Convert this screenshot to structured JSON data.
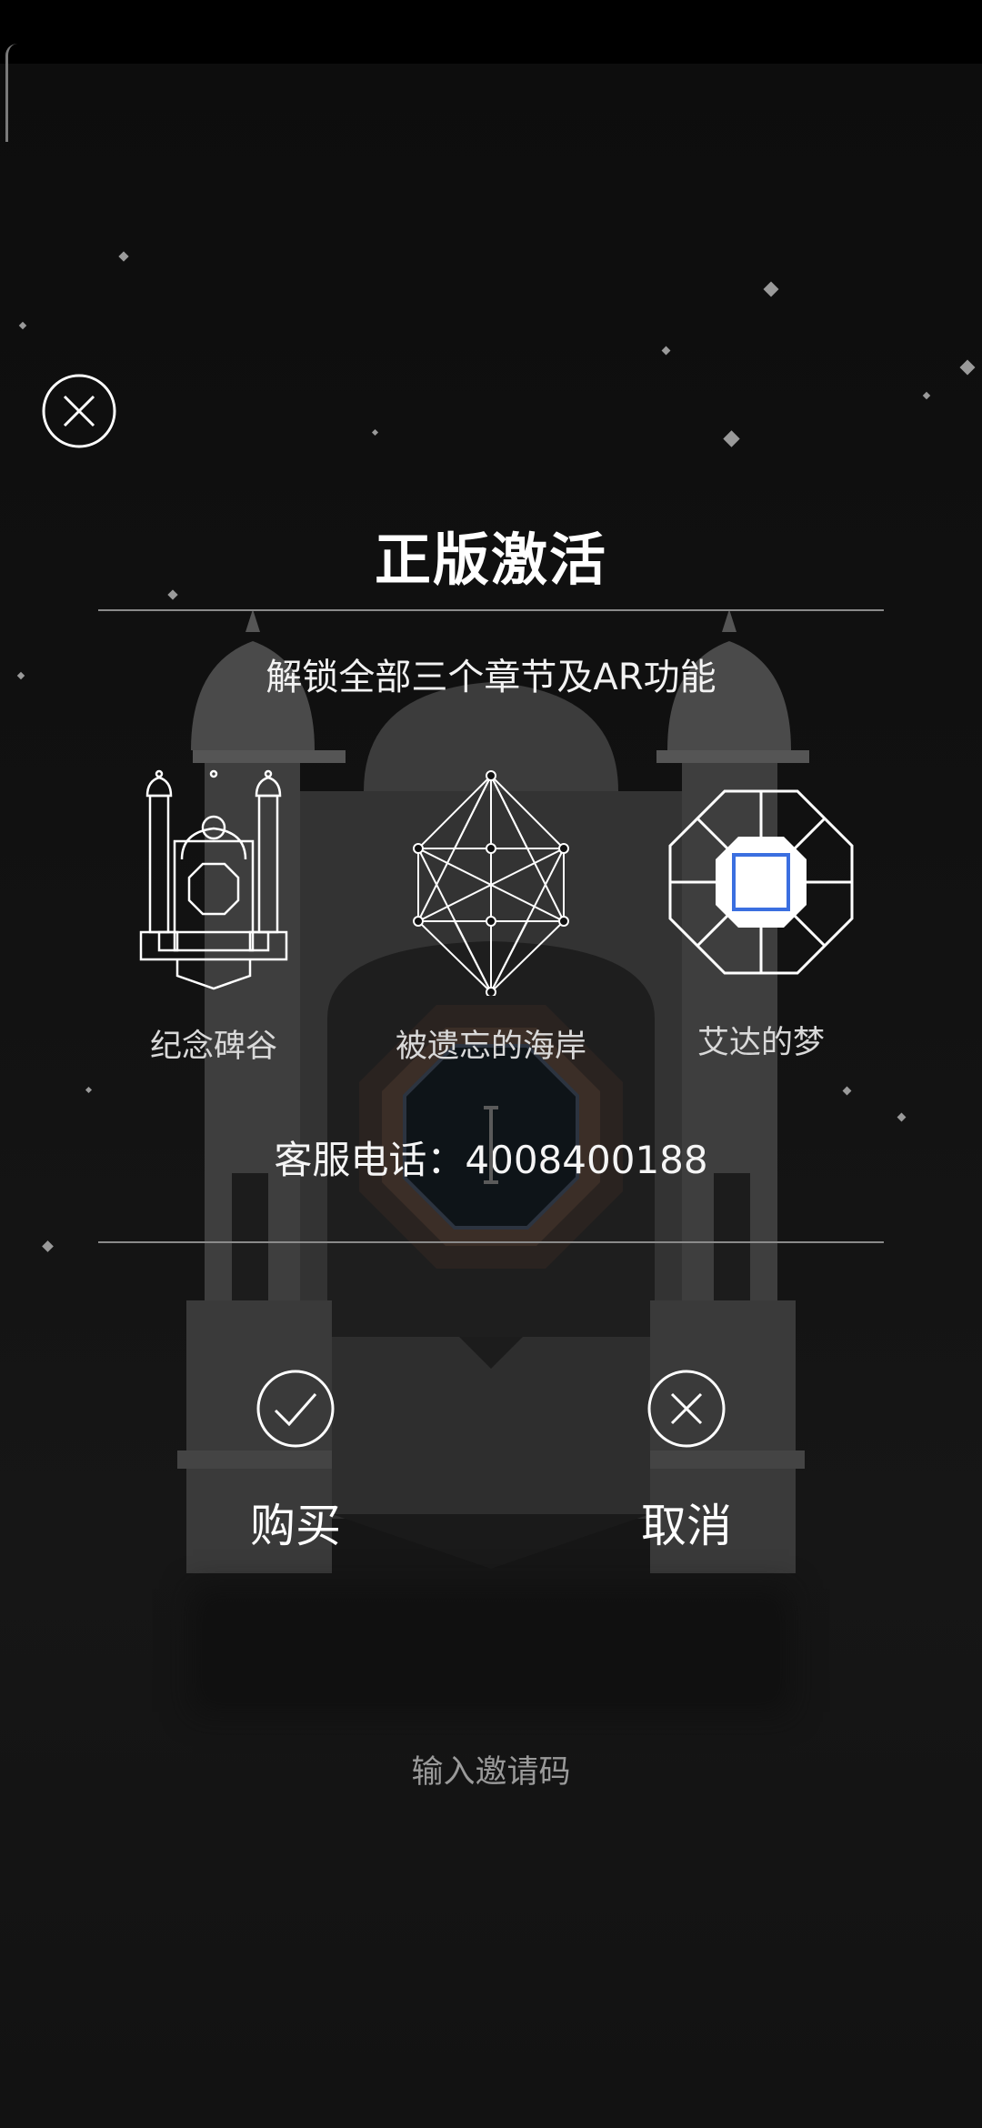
{
  "dialog": {
    "title": "正版激活",
    "subtitle": "解锁全部三个章节及AR功能",
    "chapters": [
      {
        "label": "纪念碑谷",
        "icon": "temple-icon"
      },
      {
        "label": "被遗忘的海岸",
        "icon": "crystal-lattice-icon"
      },
      {
        "label": "艾达的梦",
        "icon": "octagon-gem-icon"
      }
    ],
    "support_phone": "客服电话：4008400188",
    "buy_label": "购买",
    "cancel_label": "取消",
    "invite_label": "输入邀请码"
  },
  "icons": {
    "close": "close-icon",
    "buy": "checkmark-icon",
    "cancel": "x-icon"
  },
  "colors": {
    "background": "#0c0c0c",
    "text": "#ffffff",
    "accent_blue": "#3b6fe0",
    "muted": "#9a9a9a"
  }
}
